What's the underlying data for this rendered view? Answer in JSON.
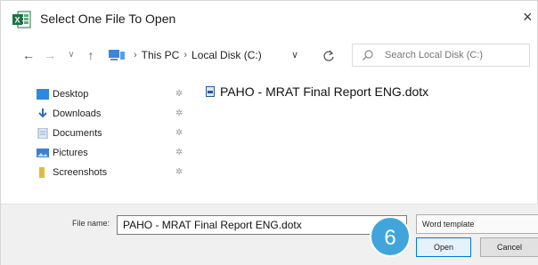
{
  "window": {
    "title": "Select One File To Open",
    "close_glyph": "×",
    "app_icon": "excel-icon"
  },
  "nav": {
    "back_glyph": "←",
    "forward_glyph": "→",
    "recent_glyph": "∨",
    "up_glyph": "↑",
    "breadcrumb": [
      "This PC",
      "Local Disk (C:)"
    ],
    "dropdown_glyph": "∨",
    "refresh_icon": "refresh-icon"
  },
  "search": {
    "placeholder": "Search Local Disk (C:)"
  },
  "sidebar": {
    "items": [
      {
        "label": "Desktop",
        "icon": "desktop-icon",
        "color": "#2b8ae0"
      },
      {
        "label": "Downloads",
        "icon": "download-icon",
        "color": "#2b6fc4"
      },
      {
        "label": "Documents",
        "icon": "documents-icon",
        "color": "#8aa8c8"
      },
      {
        "label": "Pictures",
        "icon": "pictures-icon",
        "color": "#3b7fd0"
      },
      {
        "label": "Screenshots",
        "icon": "folder-icon",
        "color": "#e8b93a"
      }
    ],
    "pin_glyph": "✲"
  },
  "files": [
    {
      "name": "PAHO - MRAT Final Report ENG.dotx",
      "icon": "word-template-icon"
    }
  ],
  "footer": {
    "file_name_label": "File name:",
    "file_name_value": "PAHO - MRAT Final Report ENG.dotx",
    "file_type": "Word template",
    "open_label": "Open",
    "cancel_label": "Cancel"
  },
  "annotation": {
    "step_number": "6",
    "color": "#41a5dc"
  },
  "colors": {
    "excel_green": "#1e7145",
    "accent_blue": "#0078d7"
  }
}
